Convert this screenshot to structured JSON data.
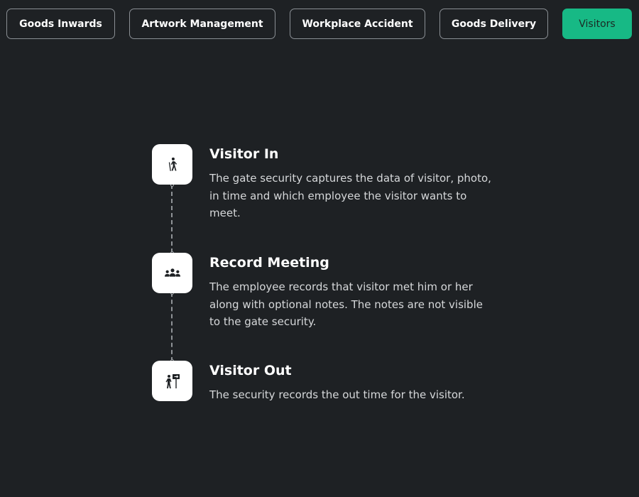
{
  "tabs": [
    {
      "label": "Goods Inwards",
      "active": false
    },
    {
      "label": "Artwork Management",
      "active": false
    },
    {
      "label": "Workplace Accident",
      "active": false
    },
    {
      "label": "Goods Delivery",
      "active": false
    },
    {
      "label": "Visitors",
      "active": true
    }
  ],
  "colors": {
    "background": "#1e2124",
    "accent": "#17b985",
    "tab_border": "#8a8f94",
    "text": "#ffffff",
    "muted_text": "#d6d8da"
  },
  "steps": [
    {
      "icon": "walking-person-icon",
      "title": "Visitor In",
      "description": "The gate security captures the data of visitor, photo, in time and which employee the visitor wants to meet."
    },
    {
      "icon": "meeting-group-icon",
      "title": "Record Meeting",
      "description": "The employee records that visitor met him or her along with optional notes. The notes are not visible to the gate security."
    },
    {
      "icon": "exit-sign-person-icon",
      "title": "Visitor Out",
      "description": "The security records the out time for the visitor."
    }
  ]
}
